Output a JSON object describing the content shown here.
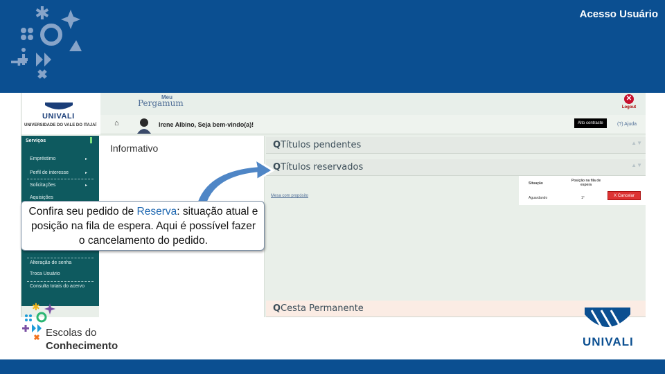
{
  "slide": {
    "title": "Acesso Usuário",
    "callout_pre": "Confira seu pedido de ",
    "callout_highlight": "Reserva",
    "callout_post": ": situação atual e posição na fila de espera. Aqui é possível fazer o cancelamento do pedido.",
    "escolas_line1": "Escolas do",
    "escolas_line2": "Conhecimento",
    "univali_footer": "UNIVALI"
  },
  "screenshot": {
    "logo": {
      "name": "UNIVALI",
      "subtitle": "UNIVERSIDADE DO VALE DO ITAJAÍ"
    },
    "app": {
      "meu": "Meu",
      "name": "Pergamum"
    },
    "logout_label": "Logout",
    "user_greeting": "Irene Albino, Seja bem-vindo(a)!",
    "contrast_button": "Alto contraste",
    "help_label": "(?) Ajuda",
    "sidebar": {
      "heading": "Serviços",
      "items": [
        {
          "label": "Empréstimo"
        },
        {
          "label": "Perfil de interesse"
        },
        {
          "label": "Solicitações"
        },
        {
          "label": "Aquisições"
        },
        {
          "label": "Alteração de senha"
        },
        {
          "label": "Troca Usuário"
        },
        {
          "label": "Consulta totais do acervo"
        }
      ]
    },
    "informativo_title": "Informativo",
    "panels": {
      "pendentes": "Títulos pendentes",
      "reservados": "Títulos reservados",
      "cesta": "Cesta Permanente"
    },
    "reservas_table": {
      "col_situacao": "Situação",
      "col_posicao": "Posição na fila de espera",
      "row_situacao": "Aguardando",
      "row_posicao": "1°",
      "cancel_button": "X Cancelar"
    },
    "mesa_link": "Mesa com propósito"
  },
  "colors": {
    "brand_blue": "#0b4f91",
    "sidebar_teal": "#0e5a5f",
    "cancel_red": "#dd3333",
    "highlight_blue": "#1c66b0"
  }
}
